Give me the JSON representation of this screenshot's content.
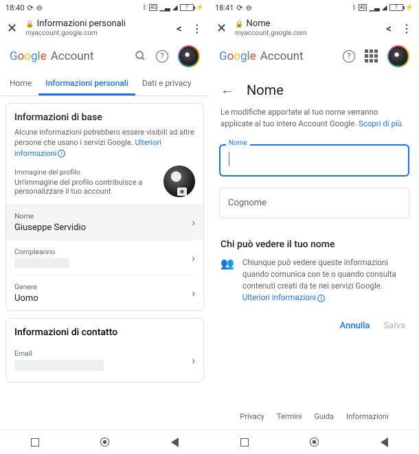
{
  "left": {
    "status": {
      "time": "18:40",
      "battery": "7"
    },
    "browser": {
      "title": "Informazioni personali",
      "url": "myaccount.google.com"
    },
    "account_label": "Account",
    "tabs": {
      "home": "Home",
      "personal": "Informazioni personali",
      "privacy": "Dati e privacy"
    },
    "basic": {
      "heading": "Informazioni di base",
      "desc": "Alcune informazioni potrebbero essere visibili ad altre persone che usano i servizi Google.",
      "more": "Ulteriori informazioni",
      "profile_label": "Immagine del profilo",
      "profile_desc": "Un'immagine del profilo contribuisce a personalizzare il tuo account",
      "name_label": "Nome",
      "name_value": "Giuseppe Servidio",
      "bday_label": "Compleanno",
      "gender_label": "Genere",
      "gender_value": "Uomo"
    },
    "contact": {
      "heading": "Informazioni di contatto",
      "email_label": "Email"
    }
  },
  "right": {
    "status": {
      "time": "18:41",
      "battery": "7"
    },
    "browser": {
      "title": "Nome",
      "url": "myaccount.google.com"
    },
    "account_label": "Account",
    "page_title": "Nome",
    "desc": "Le modifiche apportate al tuo nome verranno applicate al tuo intero Account Google.",
    "learn_more": "Scopri di più",
    "field_name": "Nome",
    "field_surname": "Cognome",
    "visibility_heading": "Chi può vedere il tuo nome",
    "visibility_text": "Chiunque può vedere queste informazioni quando comunica con te o quando consulta contenuti creati da te nei servizi Google.",
    "visibility_more": "Ulteriori informazioni",
    "cancel": "Annulla",
    "save": "Salva",
    "footer": {
      "privacy": "Privacy",
      "terms": "Termini",
      "help": "Guida",
      "info": "Informazioni"
    }
  }
}
